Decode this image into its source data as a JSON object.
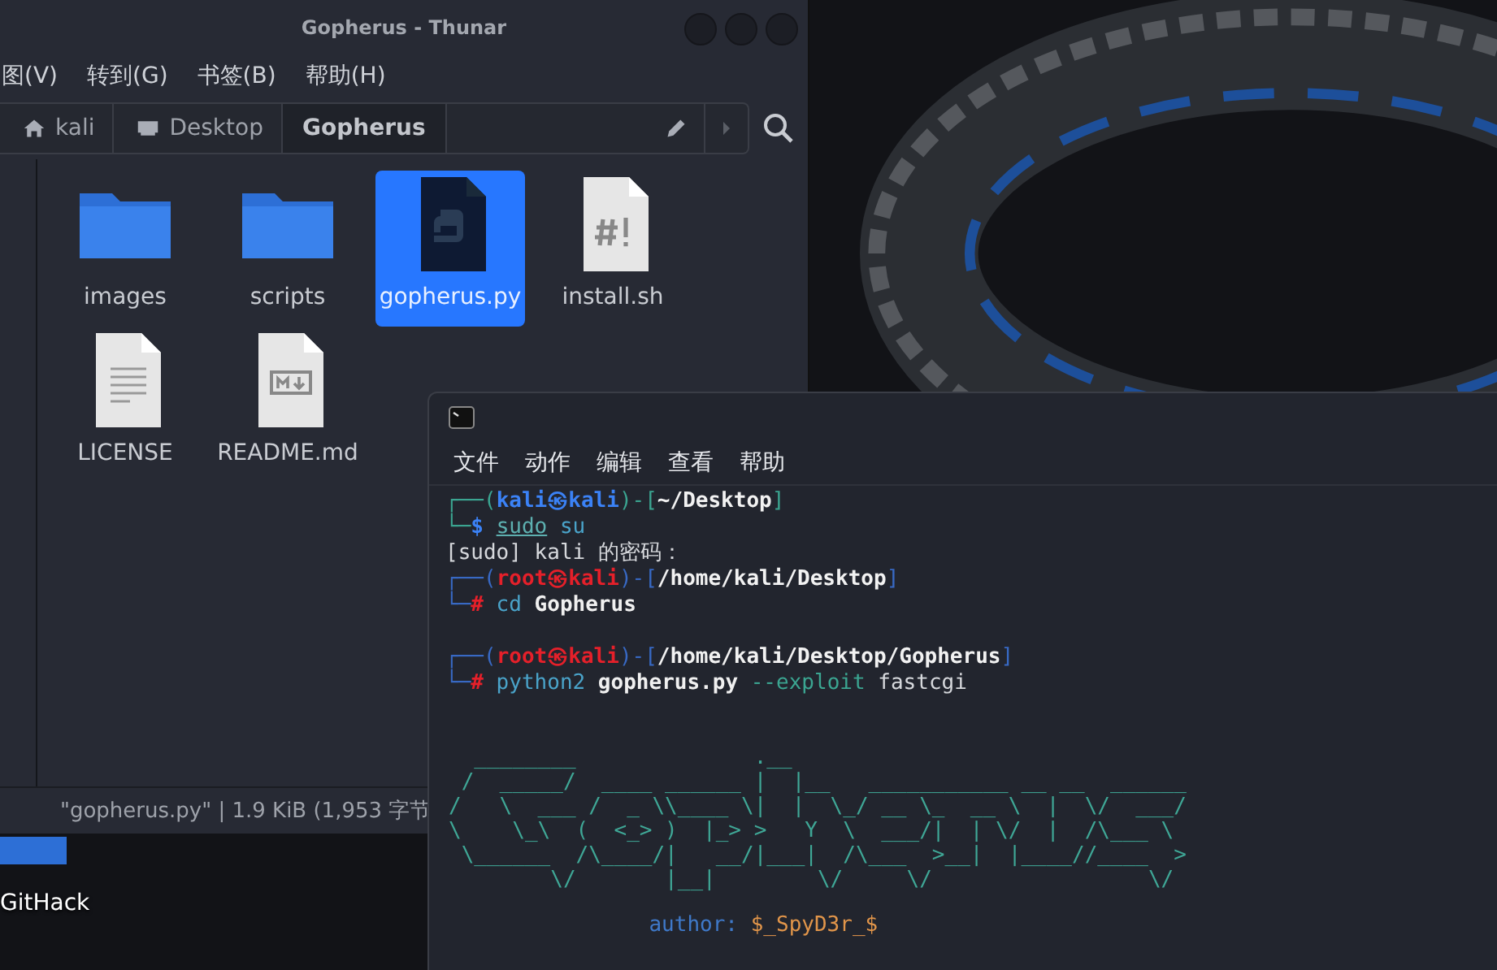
{
  "thunar": {
    "title": "Gopherus - Thunar",
    "menu": [
      "图(V)",
      "转到(G)",
      "书签(B)",
      "帮助(H)"
    ],
    "path": [
      {
        "label": "kali",
        "kind": "home",
        "selected": false
      },
      {
        "label": "Desktop",
        "kind": "desktop",
        "selected": false
      },
      {
        "label": "Gopherus",
        "kind": "plain",
        "selected": true
      }
    ],
    "files": [
      {
        "name": "images",
        "kind": "folder",
        "selected": false
      },
      {
        "name": "scripts",
        "kind": "folder",
        "selected": false
      },
      {
        "name": "gopherus.py",
        "kind": "python",
        "selected": true
      },
      {
        "name": "install.sh",
        "kind": "script",
        "selected": false
      },
      {
        "name": "LICENSE",
        "kind": "text",
        "selected": false
      },
      {
        "name": "README.md",
        "kind": "markdown",
        "selected": false
      }
    ],
    "status_bar": "\"gopherus.py\" | 1.9 KiB (1,953 字节"
  },
  "desktop": {
    "icons": [
      {
        "label": "GitHack"
      }
    ]
  },
  "terminal": {
    "menu": [
      "文件",
      "动作",
      "编辑",
      "查看",
      "帮助"
    ],
    "lines": [
      {
        "blank_before": false,
        "segments": [
          {
            "kind": "frame-user",
            "text": "┌──("
          },
          {
            "kind": "user",
            "text": "kali㉿kali"
          },
          {
            "kind": "frame-user",
            "text": ")-["
          },
          {
            "kind": "path",
            "text": "~/Desktop"
          },
          {
            "kind": "frame-user",
            "text": "]"
          }
        ]
      },
      {
        "blank_before": false,
        "segments": [
          {
            "kind": "frame-user",
            "text": "└─"
          },
          {
            "kind": "user",
            "text": "$ "
          },
          {
            "kind": "cmd-underline",
            "text": "sudo"
          },
          {
            "kind": "cmd",
            "text": " su"
          }
        ]
      },
      {
        "blank_before": false,
        "segments": [
          {
            "kind": "plain",
            "text": "[sudo] kali 的密码："
          }
        ]
      },
      {
        "blank_before": false,
        "segments": [
          {
            "kind": "frame-root",
            "text": "┌──("
          },
          {
            "kind": "root",
            "text": "root㉿kali"
          },
          {
            "kind": "frame-root",
            "text": ")-["
          },
          {
            "kind": "path",
            "text": "/home/kali/Desktop"
          },
          {
            "kind": "frame-root",
            "text": "]"
          }
        ]
      },
      {
        "blank_before": false,
        "segments": [
          {
            "kind": "frame-root",
            "text": "└─"
          },
          {
            "kind": "root",
            "text": "#"
          },
          {
            "kind": "cmd",
            "text": " cd"
          },
          {
            "kind": "arg",
            "text": " Gopherus"
          }
        ]
      },
      {
        "blank_before": true,
        "segments": [
          {
            "kind": "frame-root",
            "text": "┌──("
          },
          {
            "kind": "root",
            "text": "root㉿kali"
          },
          {
            "kind": "frame-root",
            "text": ")-["
          },
          {
            "kind": "path",
            "text": "/home/kali/Desktop/Gopherus"
          },
          {
            "kind": "frame-root",
            "text": "]"
          }
        ]
      },
      {
        "blank_before": false,
        "segments": [
          {
            "kind": "frame-root",
            "text": "└─"
          },
          {
            "kind": "root",
            "text": "#"
          },
          {
            "kind": "cmd",
            "text": " python2"
          },
          {
            "kind": "arg",
            "text": " gopherus.py"
          },
          {
            "kind": "option",
            "text": " --exploit"
          },
          {
            "kind": "plain",
            "text": " fastcgi"
          }
        ]
      }
    ],
    "banner": [
      "  ________              .__",
      "\n /  _____/  ____ ______ |  |__   ___________ __ __  ______",
      "\n/   \\  ___ /  _ \\\\____ \\|  |  \\_/ __ \\_  __ \\  |  \\/  ___/",
      "\n\\    \\_\\  (  <_> )  |_> >   Y  \\  ___/|  | \\/  |  /\\___ \\",
      "\n \\______  /\\____/|   __/|___|  /\\___  >__|  |____//____  >",
      "\n        \\/       |__|        \\/     \\/                 \\/"
    ],
    "author": {
      "label": "author:",
      "value": "$_SpyD3r_$"
    }
  }
}
